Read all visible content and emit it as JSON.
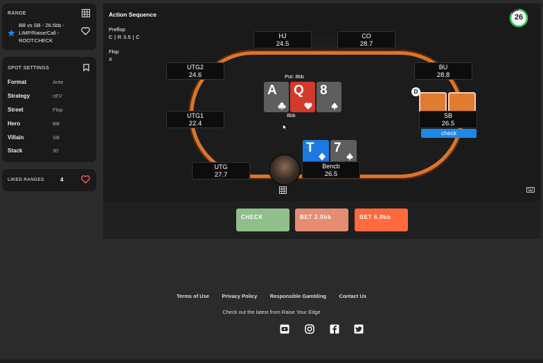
{
  "range_panel": {
    "title": "RANGE",
    "description": "BB vs SB - 26.5bb - LIMP/Raise/Call - ROOT:CHECK"
  },
  "spot_settings": {
    "title": "SPOT SETTINGS",
    "rows": [
      {
        "label": "Format",
        "value": "Ante"
      },
      {
        "label": "Strategy",
        "value": "cEV"
      },
      {
        "label": "Street",
        "value": "Flop"
      },
      {
        "label": "Hero",
        "value": "BB"
      },
      {
        "label": "Villain",
        "value": "SB"
      },
      {
        "label": "Stack",
        "value": "30"
      }
    ]
  },
  "liked_ranges": {
    "title": "LIKED RANGES",
    "count": "4"
  },
  "action_sequence": {
    "title": "Action Sequence",
    "preflop_label": "Preflop",
    "preflop_actions": "C | R 3.5 | C",
    "flop_label": "Flop",
    "flop_actions": "X"
  },
  "timer": {
    "value": "26",
    "progress": 0.85
  },
  "table": {
    "pot_label": "Pot: 8bb",
    "board_total": "8bb",
    "board": [
      {
        "rank": "A",
        "suit": "club"
      },
      {
        "rank": "Q",
        "suit": "heart"
      },
      {
        "rank": "8",
        "suit": "spade"
      }
    ],
    "seats": {
      "hj": {
        "name": "HJ",
        "stack": "24.5"
      },
      "co": {
        "name": "CO",
        "stack": "28.7"
      },
      "utg2": {
        "name": "UTG2",
        "stack": "24.6"
      },
      "bu": {
        "name": "BU",
        "stack": "28.8"
      },
      "utg1": {
        "name": "UTG1",
        "stack": "22.4"
      },
      "sb": {
        "name": "SB",
        "stack": "26.5",
        "action": "check"
      },
      "utg": {
        "name": "UTG",
        "stack": "27.7"
      },
      "hero": {
        "name": "Bencb",
        "stack": "26.5"
      }
    },
    "dealer_button": "D",
    "hero_cards": [
      {
        "rank": "T",
        "suit": "diamond"
      },
      {
        "rank": "7",
        "suit": "spade"
      }
    ]
  },
  "actions": {
    "check": "CHECK",
    "bet_small": "BET 2.0bb",
    "bet_large": "BET 6.0bb"
  },
  "footer": {
    "links": [
      "Terms of Use",
      "Privacy Policy",
      "Responsible Gambling",
      "Contact Us"
    ],
    "tagline": "Check out the latest from Raise Your Edge",
    "socials": [
      "youtube-icon",
      "instagram-icon",
      "facebook-icon",
      "twitter-icon"
    ]
  },
  "colors": {
    "accent_blue": "#1e88e5",
    "check_green": "#8fbf8a",
    "bet_small": "#e58c72",
    "bet_large": "#ff6a3d",
    "rail_orange": "#d9752b",
    "timer_green": "#34c759"
  }
}
